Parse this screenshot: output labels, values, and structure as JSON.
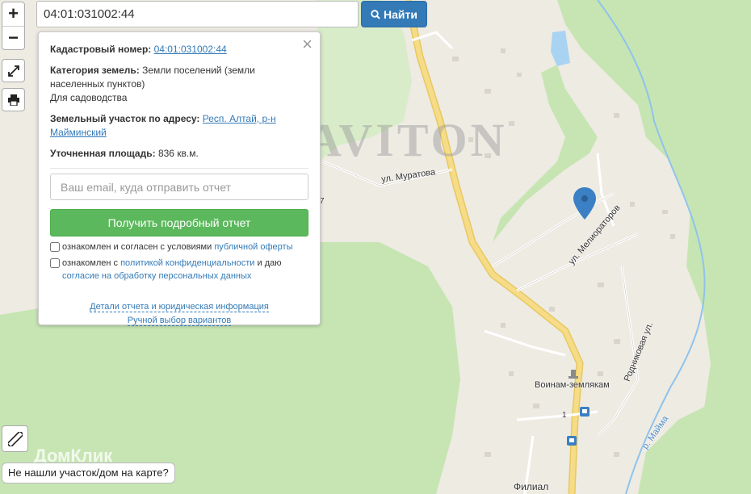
{
  "search": {
    "value": "04:01:031002:44",
    "button_label": "Найти"
  },
  "zoom": {
    "in_label": "+",
    "out_label": "−"
  },
  "panel": {
    "cadastral_label": "Кадастровый номер:",
    "cadastral_value": "04:01:031002:44",
    "category_label": "Категория земель:",
    "category_value": "Земли поселений (земли населенных пунктов)",
    "category_use": "Для садоводства",
    "address_label": "Земельный участок по адресу:",
    "address_value": "Респ. Алтай, р-н Майминский",
    "area_label": "Уточненная площадь:",
    "area_value": "836 кв.м.",
    "email_placeholder": "Ваш email, куда отправить отчет",
    "report_button": "Получить подробный отчет",
    "check1_text": "ознакомлен и согласен с условиями ",
    "check1_link": "публичной оферты",
    "check2_text": "ознакомлен с ",
    "check2_link": "политикой конфиденциальности",
    "check2_mid": " и даю ",
    "check2_link2": "согласие на обработку персональных данных",
    "link_details": "Детали отчета и юридическая информация",
    "link_manual": "Ручной выбор вариантов"
  },
  "map": {
    "watermark": "GRAVITON",
    "brand": "ДомКлик",
    "labels": {
      "muratova": "ул. Муратова",
      "melioratorov": "ул. Мелиораторов",
      "rodnikovaya": "Родниковая ул.",
      "voinam": "Воинам-землякам",
      "filial": "Филиал",
      "river": "р. Майма",
      "number1": "1",
      "number7": "7"
    },
    "colors": {
      "green": "#c7e5b3",
      "base": "#eeebe3",
      "road": "#f6dc87",
      "water": "#a9d3f2",
      "marker": "#3b7fc4"
    }
  },
  "not_found": "Не нашли участок/дом на карте?"
}
